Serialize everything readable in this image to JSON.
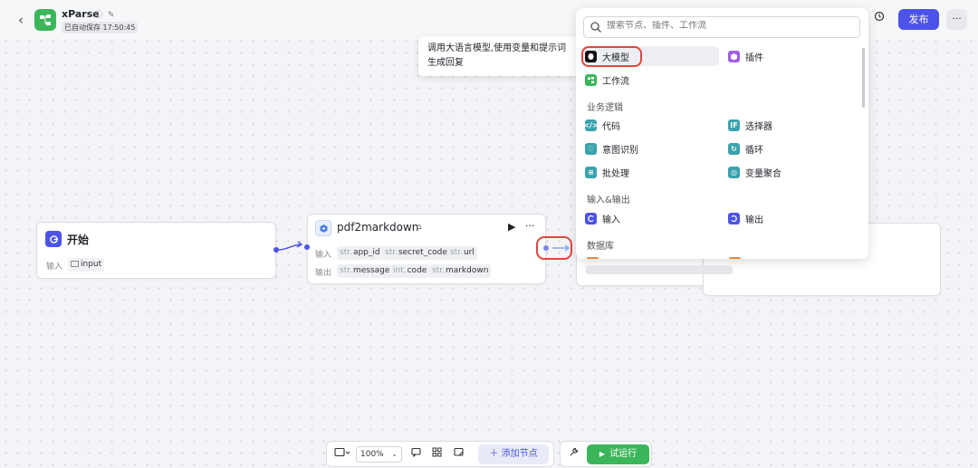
{
  "header": {
    "app_name": "xParse",
    "save_status": "已自动保存 17:50:45",
    "publish_label": "发布",
    "more_label": "···"
  },
  "start_node": {
    "title": "开始",
    "input_label": "输入",
    "input_field": "input"
  },
  "pdf_node": {
    "title": "pdf2markdown",
    "input_label": "输入",
    "output_label": "输出",
    "inputs": [
      {
        "type": "str.",
        "name": "app_id"
      },
      {
        "type": "str.",
        "name": "secret_code"
      },
      {
        "type": "str.",
        "name": "url"
      }
    ],
    "outputs": [
      {
        "type": "str.",
        "name": "message"
      },
      {
        "type": "int.",
        "name": "code"
      },
      {
        "type": "str.",
        "name": "markdown"
      }
    ],
    "more_label": "···"
  },
  "tooltip": {
    "text": "调用大语言模型,使用变量和提示词生成回复"
  },
  "panel": {
    "search_placeholder": "搜索节点、插件、工作流",
    "items_top": [
      {
        "label": "大模型",
        "color": "#111111",
        "icon": "llm-icon"
      },
      {
        "label": "插件",
        "color": "#a35ee0",
        "icon": "plugin-icon"
      },
      {
        "label": "工作流",
        "color": "#3cb65b",
        "icon": "workflow-icon"
      }
    ],
    "section_logic": "业务逻辑",
    "items_logic": [
      {
        "label": "代码",
        "color": "#3aa3ad",
        "icon": "code-icon"
      },
      {
        "label": "选择器",
        "color": "#3aa3ad",
        "icon": "selector-icon"
      },
      {
        "label": "意图识别",
        "color": "#3aa3ad",
        "icon": "intent-icon"
      },
      {
        "label": "循环",
        "color": "#3aa3ad",
        "icon": "loop-icon"
      },
      {
        "label": "批处理",
        "color": "#3aa3ad",
        "icon": "batch-icon"
      },
      {
        "label": "变量聚合",
        "color": "#3aa3ad",
        "icon": "aggregate-icon"
      }
    ],
    "section_io": "输入&输出",
    "items_io": [
      {
        "label": "输入",
        "color": "#4d53e8",
        "icon": "input-icon"
      },
      {
        "label": "输出",
        "color": "#4d53e8",
        "icon": "output-icon"
      }
    ],
    "section_db": "数据库"
  },
  "toolbar": {
    "zoom": "100%",
    "add_node_label": "添加节点",
    "run_label": "试运行"
  },
  "colors": {
    "accent": "#4d53e8",
    "run_green": "#3cb65b",
    "highlight_red": "#e2463b"
  }
}
